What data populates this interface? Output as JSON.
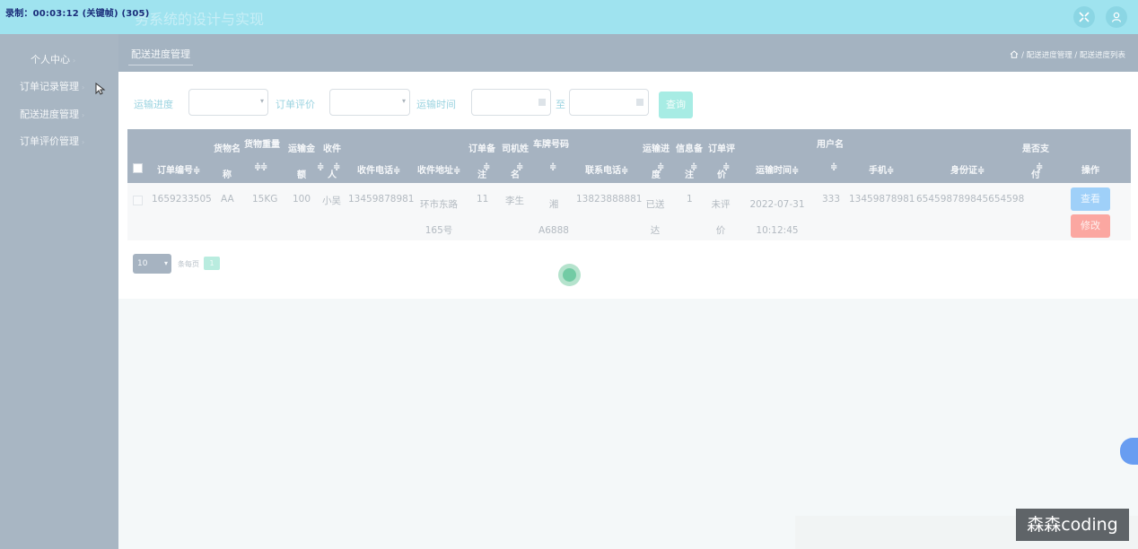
{
  "recording_overlay": "录制：00:03:12 (关键帧) (305)",
  "app_title": "务系统的设计与实现",
  "header_icons": [
    "fullscreen-icon",
    "user-icon"
  ],
  "sidebar": {
    "items": [
      {
        "label": "个人中心"
      },
      {
        "label": "订单记录管理"
      },
      {
        "label": "配送进度管理"
      },
      {
        "label": "订单评价管理"
      }
    ]
  },
  "breadcrumb_bar": {
    "tab_label": "配送进度管理",
    "home_icon": "home-icon",
    "path": "/ 配送进度管理 / 配送进度列表"
  },
  "filters": {
    "progress_label": "运输进度",
    "progress_value": "",
    "evaluation_label": "订单评价",
    "evaluation_value": "",
    "time_label": "运输时间",
    "time_from": "",
    "to_label": "至",
    "time_to": "",
    "search_label": "查询"
  },
  "table": {
    "headers": {
      "order_no": "订单编号",
      "goods_name": "货物名称",
      "weight": "货物重量",
      "freight": "运输金额",
      "receiver": "收件人",
      "receiver_phone": "收件电话",
      "receiver_address": "收件地址",
      "order_note": "订单备注",
      "driver_name": "司机姓名",
      "plate": "车牌号码",
      "contact_phone": "联系电话",
      "progress": "运输进度",
      "info_note": "信息备注",
      "evaluation": "订单评价",
      "transport_time": "运输时间",
      "username": "用户名",
      "mobile": "手机",
      "id_card": "身份证",
      "paid": "是否支付",
      "actions": "操作"
    },
    "rows": [
      {
        "order_no": "1659233505",
        "goods_name": "AA",
        "weight": "15KG",
        "freight": "100",
        "receiver": "小吴",
        "receiver_phone": "13459878981",
        "receiver_address": "环市东路165号",
        "order_note": "11",
        "driver_name": "李生",
        "plate": "湘A6888",
        "contact_phone": "13823888881",
        "progress": "已送达",
        "info_note": "1",
        "evaluation": "未评价",
        "transport_time": "2022-07-31 10:12:45",
        "username": "333",
        "mobile": "13459878981",
        "id_card": "654598789845654598",
        "paid": "",
        "view_label": "查看",
        "edit_label": "修改"
      }
    ]
  },
  "pagination": {
    "page_size": "10",
    "per_page_label": "条每页",
    "current_page": "1"
  },
  "watermark": "森森coding"
}
